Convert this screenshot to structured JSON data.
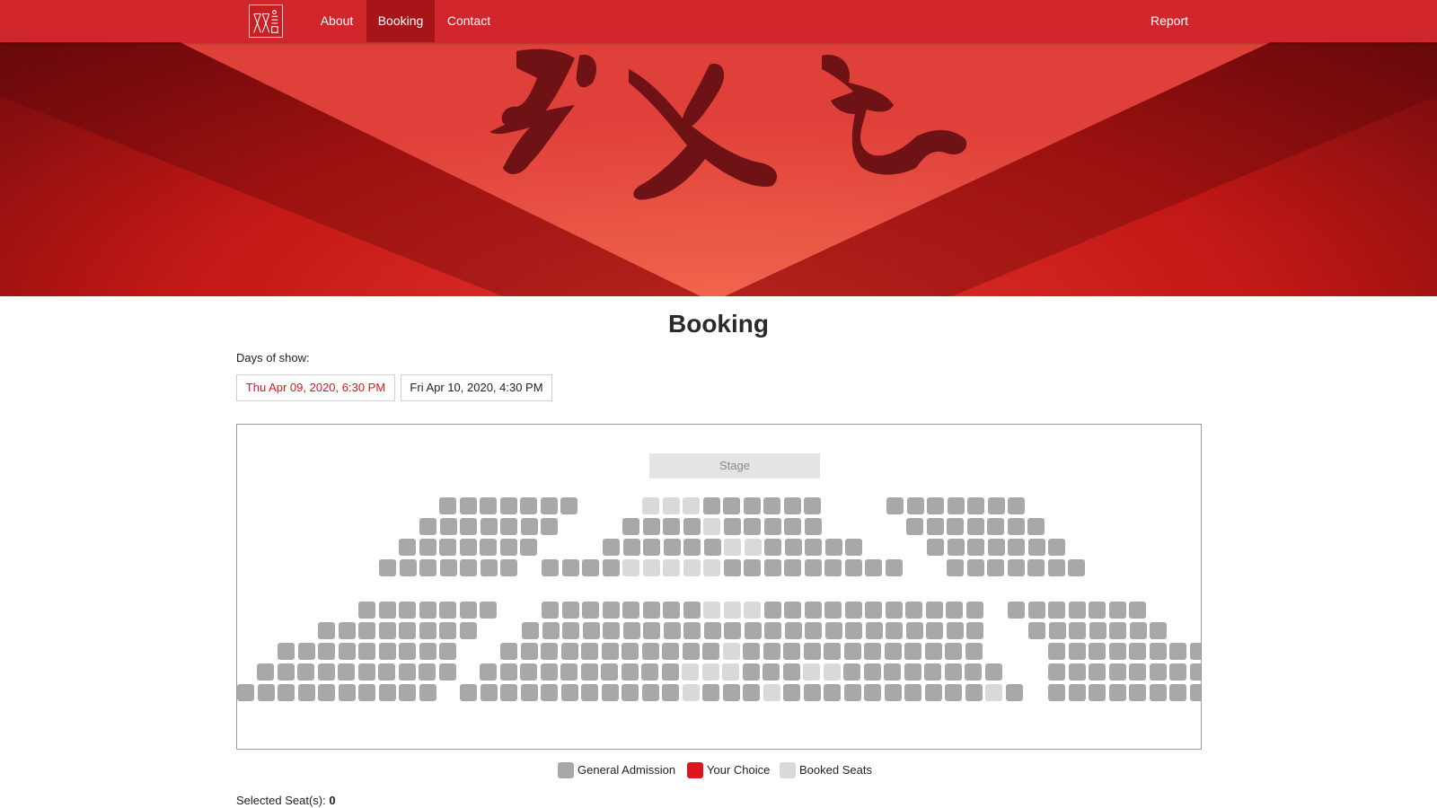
{
  "nav": {
    "items": [
      {
        "id": "about",
        "label": "About"
      },
      {
        "id": "booking",
        "label": "Booking"
      },
      {
        "id": "contact",
        "label": "Contact"
      }
    ],
    "active": "Booking",
    "right_label": "Report"
  },
  "page": {
    "title": "Booking"
  },
  "days": {
    "label": "Days of show:",
    "options": [
      "Thu Apr 09, 2020, 6:30 PM",
      "Fri Apr 10, 2020, 4:30 PM"
    ],
    "selected": "Thu Apr 09, 2020, 6:30 PM"
  },
  "seatmap": {
    "stage_label": "Stage"
  },
  "legend": {
    "general_admission": "General Admission",
    "your_choice": "Your Choice",
    "booked_seats": "Booked Seats"
  },
  "selection": {
    "label": "Selected Seat(s): ",
    "count": "0"
  },
  "colors": {
    "brand_red": "#d0262c",
    "active_nav": "#a81519",
    "general_admission": "#a8a8a8",
    "your_choice": "#e0141b",
    "booked": "#d9d9d9"
  }
}
